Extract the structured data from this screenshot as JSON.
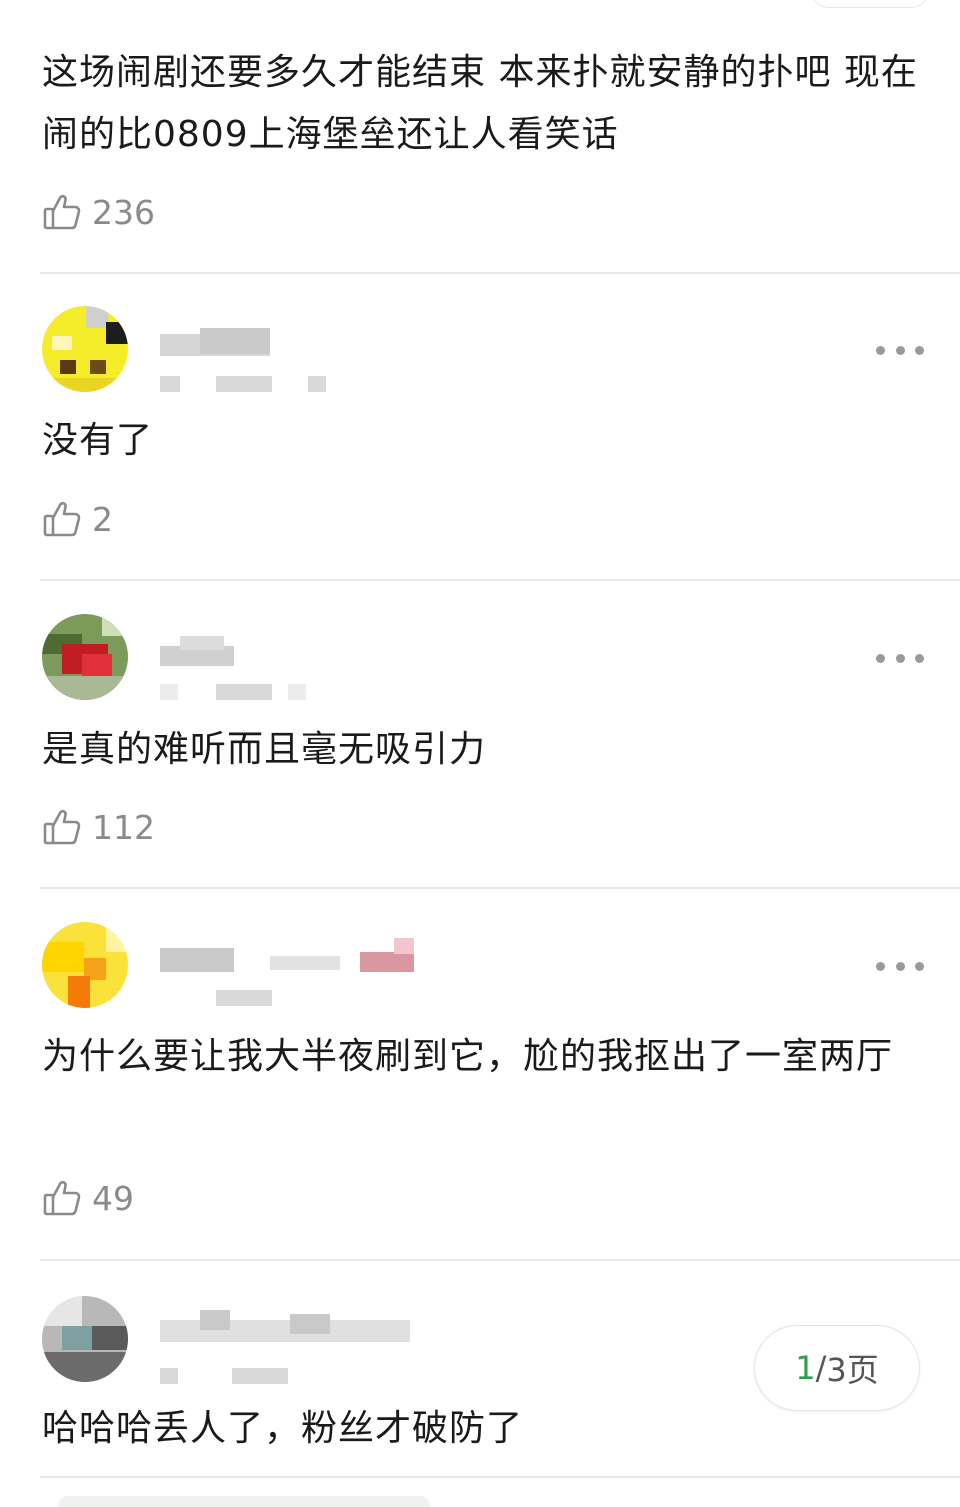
{
  "pager": {
    "current": "1",
    "separator": "/",
    "total_text": "3页"
  },
  "comments": [
    {
      "text": "这场闹剧还要多久才能结束 本来扑就安静的扑吧 现在闹的比0809上海堡垒还让人看笑话",
      "likes": "236"
    },
    {
      "text": "没有了",
      "likes": "2"
    },
    {
      "text": "是真的难听而且毫无吸引力",
      "likes": "112"
    },
    {
      "text": "为什么要让我大半夜刷到它，尬的我抠出了一室两厅",
      "likes": "49"
    },
    {
      "text": "哈哈哈丢人了，粉丝才破防了",
      "likes": ""
    }
  ],
  "colors": {
    "text": "#1a1a1a",
    "like_count": "#8a8a8a",
    "pager_current": "#2e9e4f",
    "divider": "#e8e8e8"
  },
  "icons": {
    "like": "thumbs-up-icon",
    "more": "more-dots-icon"
  }
}
